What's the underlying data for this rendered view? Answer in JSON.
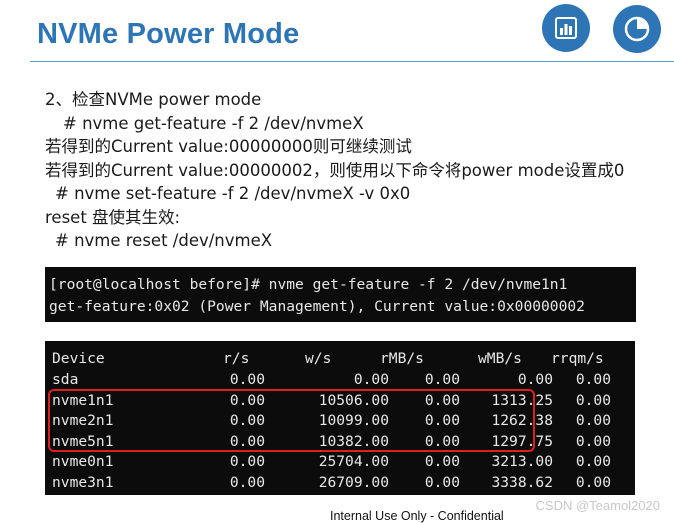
{
  "slide": {
    "title": "NVMe Power Mode",
    "lines": [
      "2、检查NVMe power mode",
      "# nvme get-feature -f 2 /dev/nvmeX",
      "若得到的Current value:00000000则可继续测试",
      "若得到的Current value:00000002，则使用以下命令将power mode设置成0",
      "# nvme set-feature -f 2 /dev/nvmeX -v 0x0",
      "reset 盘使其生效:",
      "# nvme reset /dev/nvmeX"
    ],
    "icons": {
      "left": "bar-chart-icon",
      "right": "pie-chart-icon"
    },
    "accent_color": "#2e75b6",
    "highlight_color": "#e02020"
  },
  "terminal1": {
    "lines": [
      "[root@localhost before]# nvme get-feature -f 2 /dev/nvme1n1",
      "get-feature:0x02 (Power Management), Current value:0x00000002"
    ]
  },
  "terminal2": {
    "headers": [
      "Device",
      "r/s",
      "w/s",
      "rMB/s",
      "wMB/s",
      "rrqm/s"
    ],
    "rows": [
      [
        "sda",
        "0.00",
        "0.00",
        "0.00",
        "0.00",
        "0.00"
      ],
      [
        "nvme1n1",
        "0.00",
        "10506.00",
        "0.00",
        "1313.25",
        "0.00"
      ],
      [
        "nvme2n1",
        "0.00",
        "10099.00",
        "0.00",
        "1262.38",
        "0.00"
      ],
      [
        "nvme5n1",
        "0.00",
        "10382.00",
        "0.00",
        "1297.75",
        "0.00"
      ],
      [
        "nvme0n1",
        "0.00",
        "25704.00",
        "0.00",
        "3213.00",
        "0.00"
      ],
      [
        "nvme3n1",
        "0.00",
        "26709.00",
        "0.00",
        "3338.62",
        "0.00"
      ]
    ]
  },
  "watermark": "CSDN @Teamol2020",
  "footer": "Internal Use Only - Confidential"
}
